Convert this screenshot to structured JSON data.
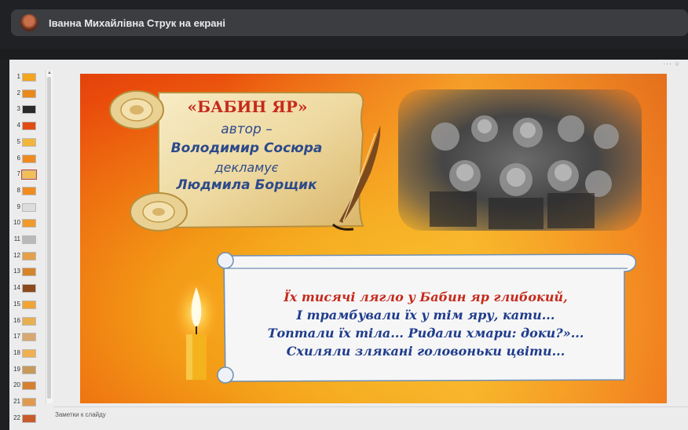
{
  "meeting": {
    "presenter_text": "Іванна Михайлівна Струк на екрані"
  },
  "sidebar": {
    "slide_numbers": [
      "1",
      "2",
      "3",
      "4",
      "5",
      "6",
      "7",
      "8",
      "9",
      "10",
      "11",
      "12",
      "13",
      "14",
      "15",
      "16",
      "17",
      "18",
      "19",
      "20",
      "21",
      "22"
    ],
    "selected": "7"
  },
  "slide": {
    "title": "«БАБИН ЯР»",
    "author_label": "автор –",
    "author_name": "Володимир Сосюра",
    "recite_label": "декламує",
    "reader_name": "Людмила Борщик",
    "poem_lines": [
      "Їх тисячі лягло у Бабин яр глибокий,",
      "І трамбували їх у тім яру, кати...",
      "Топтали їх тіла... Ридали хмари: доки?»...",
      "Схиляли злякані головоньки цвіти..."
    ]
  },
  "notes": {
    "placeholder": "Заметки к слайду"
  },
  "colors": {
    "title_red": "#c62a1c",
    "text_blue": "#2c4a8a",
    "poem_first_line": "#c62a1c",
    "poem_lines": "#1f3c8c"
  },
  "icons": {
    "avatar": "presenter-avatar",
    "window_controls": "more-dots-icon"
  }
}
